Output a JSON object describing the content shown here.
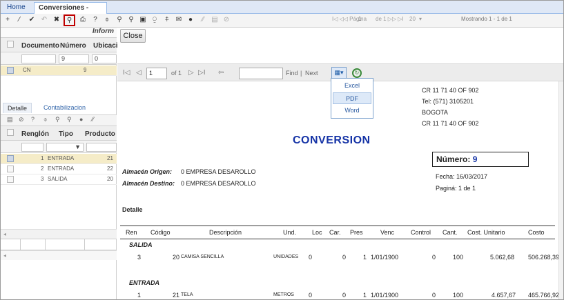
{
  "tabs": {
    "home": "Home",
    "active": "Conversiones -[icnv]",
    "close": "×"
  },
  "toolbar": {
    "icons": [
      "+",
      "⁄",
      "✔",
      "↶",
      "✖",
      "⚲",
      "⎙",
      "?",
      "⌽",
      "⚲",
      "⚲",
      "▣",
      "⍜",
      "⍏",
      "✉",
      "●",
      "⁄⁄",
      "▤",
      "⊘"
    ],
    "pager_prev": "I◁ ◁◁ Página",
    "page": "1",
    "of": "de 1 ▷▷ ▷I",
    "size": "20",
    "size_arrow": "▾",
    "showing": "Mostrando 1 - 1 de 1"
  },
  "left": {
    "section_title": "Inform",
    "columns": [
      "Documento",
      "Número",
      "Ubicaci"
    ],
    "filter": {
      "numero": "9",
      "ubic": "0"
    },
    "main_row": {
      "doc": "CN",
      "num": "9"
    },
    "subtabs": [
      "Detalle",
      "Contabilizacion"
    ],
    "sub_icons": [
      "▤",
      "⊘",
      "?",
      "⌽",
      "⚲",
      "⚲",
      "●",
      "⁄⁄"
    ],
    "sub_columns": [
      "Renglón",
      "Tipo",
      "Producto"
    ],
    "sub_filter_arrow": "▼",
    "sub_rows": [
      {
        "n": "1",
        "tipo": "ENTRADA",
        "prod": "21"
      },
      {
        "n": "2",
        "tipo": "ENTRADA",
        "prod": "22"
      },
      {
        "n": "3",
        "tipo": "SALIDA",
        "prod": "20"
      }
    ],
    "scroll_arrow": "◂"
  },
  "right": {
    "close": "Close",
    "rv": {
      "nav_first": "I◁",
      "nav_prev": "◁",
      "page": "1",
      "of": "of 1",
      "nav_next": "▷",
      "nav_last": "▷I",
      "back": "⇦",
      "find": "Find",
      "sep": "|",
      "next": "Next",
      "export_icon": "▦▾",
      "refresh_icon": "↻"
    },
    "export_menu": [
      "Excel",
      "PDF",
      "Word"
    ],
    "report": {
      "address": [
        "CR 11 71 40 OF 902",
        "Tel: (571) 3105201",
        "BOGOTA",
        "CR 11 71 40 OF 902"
      ],
      "title": "CONVERSION",
      "numero_label": "Número:",
      "numero": "9",
      "fecha": "Fecha:  16/03/2017",
      "pagina": "Paginá: 1 de 1",
      "origen_label": "Almacén Origen:",
      "origen": "0 EMPRESA DESAROLLO",
      "destino_label": "Almacén Destino:",
      "destino": "0 EMPRESA DESAROLLO",
      "detalle": "Detalle",
      "columns": [
        "Ren",
        "Código",
        "Descripción",
        "Und.",
        "Loc",
        "Car.",
        "Pres",
        "Venc",
        "Control",
        "Cant.",
        "Cost. Unitario",
        "Costo"
      ],
      "groups": [
        {
          "name": "SALIDA",
          "rows": [
            {
              "ren": "3",
              "cod": "20",
              "desc": "CAMISA SENCILLA",
              "und": "UNIDADES",
              "loc": "0",
              "car": "0",
              "pres": "1",
              "venc": "1/01/1900",
              "control": "0",
              "cant": "100",
              "cu": "5.062,68",
              "costo": "506.268,39"
            }
          ]
        },
        {
          "name": "ENTRADA",
          "rows": [
            {
              "ren": "1",
              "cod": "21",
              "desc": "TELA",
              "und": "METROS",
              "loc": "0",
              "car": "0",
              "pres": "1",
              "venc": "1/01/1900",
              "control": "0",
              "cant": "100",
              "cu": "4.657,67",
              "costo": "465.766,92"
            }
          ]
        }
      ]
    }
  }
}
